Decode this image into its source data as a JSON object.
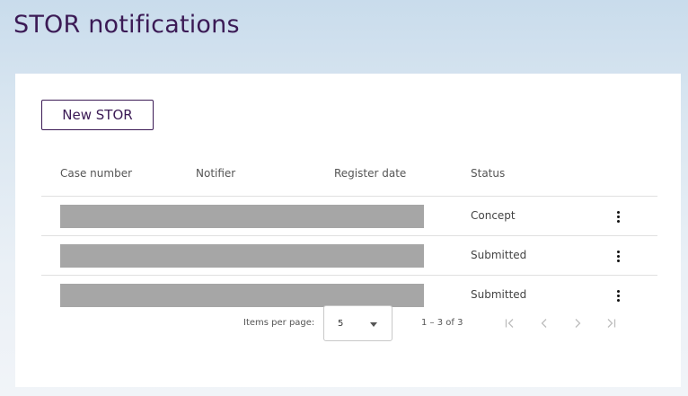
{
  "page": {
    "title": "STOR notifications"
  },
  "toolbar": {
    "new_label": "New STOR"
  },
  "table": {
    "headers": [
      "Case number",
      "Notifier",
      "Register date",
      "Status"
    ],
    "rows": [
      {
        "status": "Concept"
      },
      {
        "status": "Submitted"
      },
      {
        "status": "Submitted"
      }
    ],
    "row_menu_icon": "more-vert-icon",
    "redaction_color": "#a6a6a6"
  },
  "paginator": {
    "items_per_page_label": "Items per page:",
    "page_size": "5",
    "range_label": "1 – 3 of 3",
    "icons": [
      "first-page-icon",
      "chevron-left-icon",
      "chevron-right-icon",
      "last-page-icon"
    ]
  },
  "colors": {
    "accent": "#3b1a55",
    "card": "#ffffff",
    "background_top": "#c9dcec"
  }
}
